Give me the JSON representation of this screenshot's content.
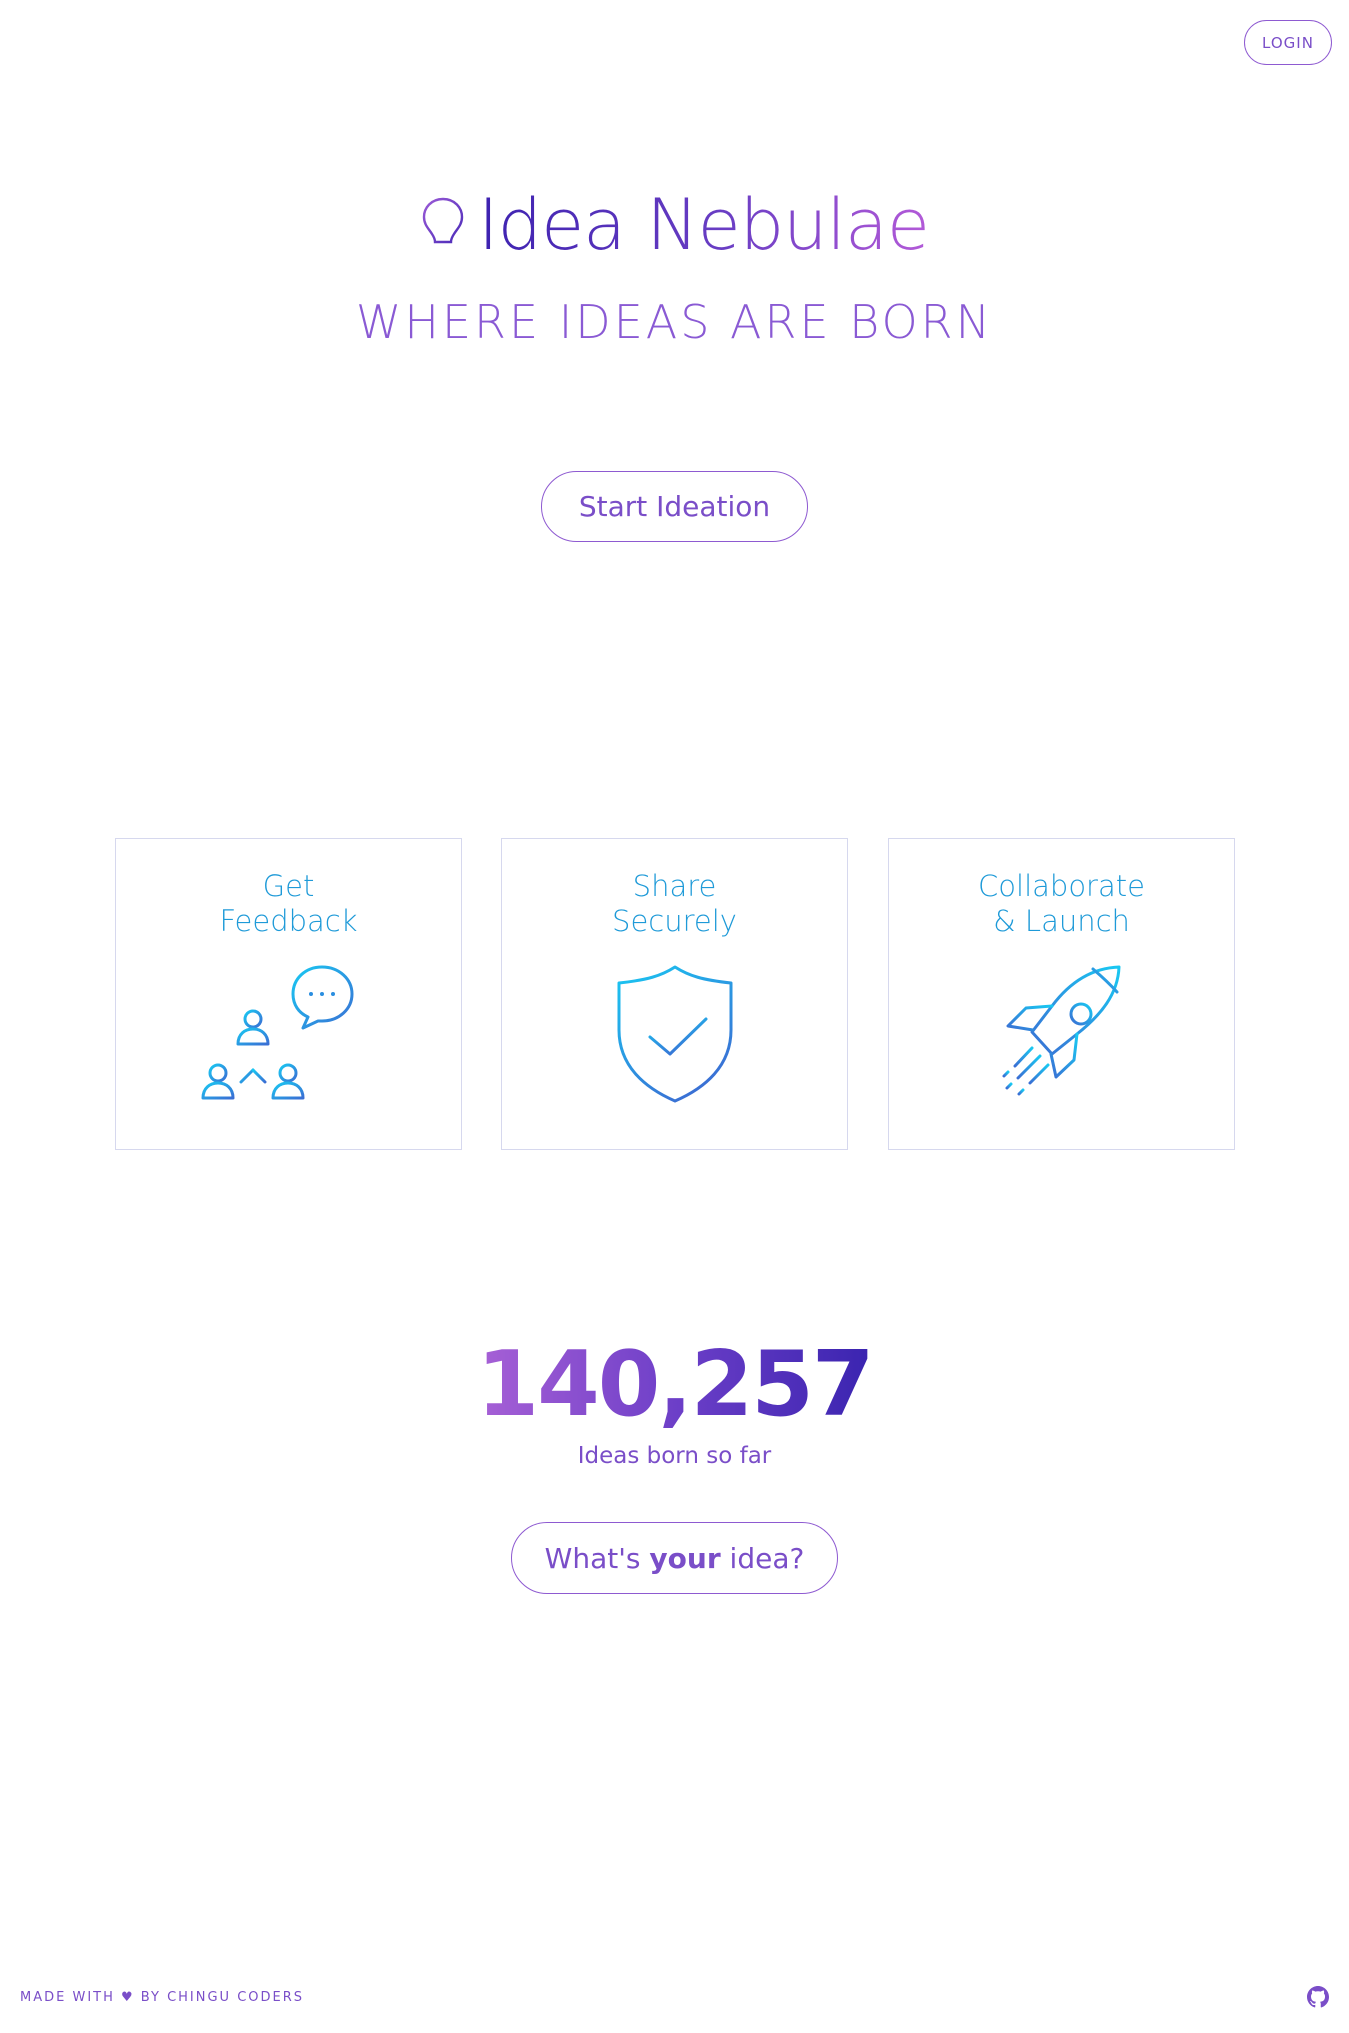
{
  "header": {
    "login_label": "LOGIN"
  },
  "hero": {
    "brand_title": "Idea Nebulae",
    "brand_icon": "lightbulb-icon",
    "tagline": "WHERE IDEAS ARE BORN",
    "start_button_label": "Start Ideation"
  },
  "features": [
    {
      "line1": "Get",
      "line2": "Feedback",
      "icon": "people-chat-icon"
    },
    {
      "line1": "Share",
      "line2": "Securely",
      "icon": "shield-check-icon"
    },
    {
      "line1": "Collaborate",
      "line2": "& Launch",
      "icon": "rocket-icon"
    }
  ],
  "stats": {
    "count": "140,257",
    "caption": "Ideas born so far"
  },
  "cta": {
    "prefix": "What's ",
    "emphasis": "your",
    "suffix": " idea?"
  },
  "footer": {
    "credit": "MADE WITH ♥ BY CHINGU CODERS",
    "github_icon": "github-icon"
  },
  "colors": {
    "accent_purple": "#7a4ec8",
    "feature_blue": "#1e9ad8",
    "card_border": "#d6d8ee"
  }
}
